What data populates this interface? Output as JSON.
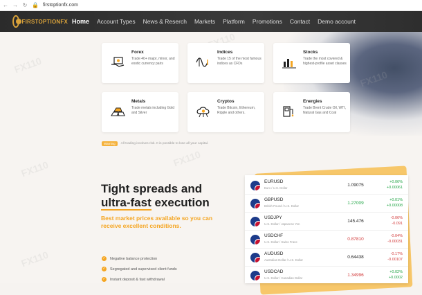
{
  "browser": {
    "url": "firstoptionfx.com"
  },
  "nav": {
    "logo": "FIRSTOPTIONFX",
    "items": [
      "Home",
      "Account Types",
      "News & Reserch",
      "Markets",
      "Platform",
      "Promotions",
      "Contact",
      "Demo account"
    ],
    "active": "Home"
  },
  "cards": [
    {
      "title": "Forex",
      "desc": "Trade 40+ major, minor, and exotic currency pairs",
      "icon": "money-hand-icon"
    },
    {
      "title": "Indices",
      "desc": "Trade 15 of the most famous indices as CFDs",
      "icon": "indices-wave-icon"
    },
    {
      "title": "Stocks",
      "desc": "Trade the most covered & highest-profile asset classes",
      "icon": "bar-chart-icon"
    },
    {
      "title": "Metals",
      "desc": "Trade metals including Gold and Silver",
      "icon": "gold-bars-icon"
    },
    {
      "title": "Cryptos",
      "desc": "Trade Bitcoin, Ethereum, Ripple and others.",
      "icon": "crypto-cloud-icon"
    },
    {
      "title": "Energies",
      "desc": "Trade Brent Crude Oil, WTI, Natural Gas and Coal",
      "icon": "oil-pump-icon"
    }
  ],
  "warning": {
    "badge": "Warning",
    "text": "All trading involves risk. It is possible to lose all your capital."
  },
  "headline": {
    "line1": "Tight spreads and",
    "line2_highlight": "ultra-fast",
    "line2_rest": " execution"
  },
  "subhead": "Best market prices available so you can receive excellent conditions.",
  "features": [
    "Negative balance protection",
    "Segregated and supervised client funds",
    "Instant deposit & fast withdrawal"
  ],
  "quotes": [
    {
      "pair": "EURUSD",
      "desc": "Euro / U.S. Dollar",
      "price": "1.09075",
      "price_state": "neutral",
      "change_pct": "+0.06%",
      "change_abs": "+0.00061",
      "direction": "pos"
    },
    {
      "pair": "GBPUSD",
      "desc": "British Pound / U.S. Dollar",
      "price": "1.27009",
      "price_state": "pos",
      "change_pct": "+0.01%",
      "change_abs": "+0.00008",
      "direction": "pos"
    },
    {
      "pair": "USDJPY",
      "desc": "U.S. Dollar / Japanese Yen",
      "price": "145.476",
      "price_state": "neutral",
      "change_pct": "-0.06%",
      "change_abs": "-0.091",
      "direction": "neg"
    },
    {
      "pair": "USDCHF",
      "desc": "U.S. Dollar / Swiss Franc",
      "price": "0.87810",
      "price_state": "neg",
      "change_pct": "-0.04%",
      "change_abs": "-0.00031",
      "direction": "neg"
    },
    {
      "pair": "AUDUSD",
      "desc": "Australian Dollar / U.S. Dollar",
      "price": "0.64438",
      "price_state": "neutral",
      "change_pct": "-0.17%",
      "change_abs": "-0.00107",
      "direction": "neg"
    },
    {
      "pair": "USDCAD",
      "desc": "U.S. Dollar / Canadian Dollar",
      "price": "1.34996",
      "price_state": "neg",
      "change_pct": "+0.02%",
      "change_abs": "+0.0002",
      "direction": "pos"
    }
  ],
  "colors": {
    "accent": "#f5a623",
    "nav_bg": "#2b2b2b",
    "positive": "#22a546",
    "negative": "#d23a3a"
  }
}
